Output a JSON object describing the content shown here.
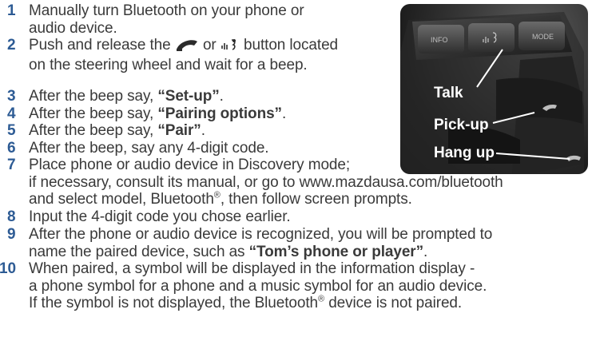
{
  "steps": [
    {
      "num": "1",
      "lines": [
        "Manually turn Bluetooth on your phone or",
        "audio device."
      ]
    },
    {
      "num": "2",
      "pre": "Push and release the",
      "mid": "or",
      "post": "button located",
      "line2": "on the steering wheel and wait for a beep."
    },
    {
      "num": "3",
      "pre": "After the beep say, ",
      "bold": "“Set-up”",
      "post": "."
    },
    {
      "num": "4",
      "pre": "After the beep say, ",
      "bold": "“Pairing options”",
      "post": "."
    },
    {
      "num": "5",
      "pre": "After the beep say, ",
      "bold": "“Pair”",
      "post": "."
    },
    {
      "num": "6",
      "text": "After the beep, say any 4-digit code."
    },
    {
      "num": "7",
      "line1": "Place phone or audio device in Discovery mode;",
      "line2": "if necessary, consult its manual, or go to www.mazdausa.com/bluetooth",
      "line3_pre": "and select model, Bluetooth",
      "line3_sup": "®",
      "line3_post": ", then follow screen prompts."
    },
    {
      "num": "8",
      "text": "Input the 4-digit code you chose earlier."
    },
    {
      "num": "9",
      "line1": "After the phone or audio device is recognized, you will be prompted to",
      "line2_pre": "name the paired device, such as ",
      "line2_bold": "“Tom’s phone or player”",
      "line2_post": "."
    },
    {
      "num": "10",
      "line1": "When paired, a symbol will be displayed in the information display -",
      "line2": "a phone symbol for a phone and a music symbol for an audio device.",
      "line3_pre": "If the symbol is not displayed, the Bluetooth",
      "line3_sup": "®",
      "line3_post": " device is not paired."
    }
  ],
  "icons": {
    "pickup": "phone-pickup-icon",
    "talk": "voice-talk-icon"
  },
  "photo": {
    "buttons": [
      "INFO",
      "MODE"
    ],
    "labels": {
      "talk": "Talk",
      "pickup": "Pick-up",
      "hangup": "Hang up"
    }
  },
  "colors": {
    "number": "#2d5b94",
    "text": "#3a3a3a"
  }
}
